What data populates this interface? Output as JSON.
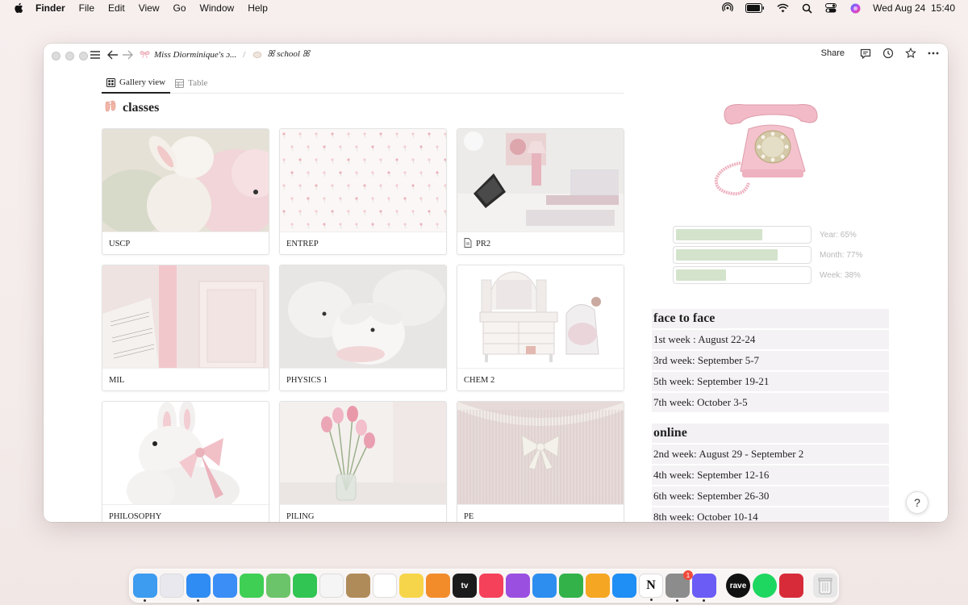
{
  "menubar": {
    "app_name": "Finder",
    "menus": [
      "File",
      "Edit",
      "View",
      "Go",
      "Window",
      "Help"
    ],
    "datetime": "Wed Aug 24  15:40"
  },
  "window": {
    "breadcrumb": {
      "page1": "Miss Diorminique's ɔ...",
      "page2": "ꕤ school ꕤ"
    },
    "share_label": "Share"
  },
  "tabs": [
    {
      "label": "Gallery view",
      "active": true
    },
    {
      "label": "Table",
      "active": false
    }
  ],
  "section_title": "classes",
  "cards": [
    {
      "label": "USCP",
      "thumb": "bunny-plush"
    },
    {
      "label": "ENTREP",
      "thumb": "floral-pattern"
    },
    {
      "label": "PR2",
      "thumb": "desk",
      "has_page_icon": true
    },
    {
      "label": "MIL",
      "thumb": "sheet-music"
    },
    {
      "label": "PHYSICS 1",
      "thumb": "white-bunny"
    },
    {
      "label": "CHEM 2",
      "thumb": "vanity"
    },
    {
      "label": "PHILOSOPHY",
      "thumb": "bunny-bow"
    },
    {
      "label": "PILING",
      "thumb": "tulips"
    },
    {
      "label": "PE",
      "thumb": "knit-bow"
    }
  ],
  "progress": [
    {
      "label": "Year: 65%",
      "value": 0.65
    },
    {
      "label": "Month: 77%",
      "value": 0.77
    },
    {
      "label": "Week: 38%",
      "value": 0.38
    }
  ],
  "face_to_face": {
    "title": "face to face",
    "items": [
      "1st week : August 22-24",
      "3rd week: September 5-7",
      "5th week: September 19-21",
      "7th week: October 3-5"
    ]
  },
  "online": {
    "title": "online",
    "items": [
      "2nd week: August 29 - September 2",
      "4th week: September 12-16",
      "6th week: September 26-30",
      "8th week: October 10-14"
    ]
  },
  "help_label": "?",
  "dock": {
    "apps": [
      {
        "name": "finder",
        "color": "#3d9bf0"
      },
      {
        "name": "launchpad",
        "color": "#e8e8ee"
      },
      {
        "name": "safari",
        "color": "#2f8cf2"
      },
      {
        "name": "mail",
        "color": "#3a8ef6"
      },
      {
        "name": "messages",
        "color": "#3fcf55"
      },
      {
        "name": "maps",
        "color": "#6cc46a"
      },
      {
        "name": "facetime",
        "color": "#31c553"
      },
      {
        "name": "photos",
        "color": "#f5f5f5"
      },
      {
        "name": "contacts",
        "color": "#b08b5a"
      },
      {
        "name": "reminders",
        "color": "#ffffff"
      },
      {
        "name": "notes",
        "color": "#f7d54a"
      },
      {
        "name": "books",
        "color": "#f28c2b"
      },
      {
        "name": "tv",
        "color": "#1b1b1b"
      },
      {
        "name": "music",
        "color": "#f5415a"
      },
      {
        "name": "podcasts",
        "color": "#9b4fe0"
      },
      {
        "name": "keynote",
        "color": "#2d8ef0"
      },
      {
        "name": "numbers",
        "color": "#33b24a"
      },
      {
        "name": "pages",
        "color": "#f5a623"
      },
      {
        "name": "app-store",
        "color": "#1f8ef5"
      },
      {
        "name": "notion",
        "color": "#ffffff"
      },
      {
        "name": "system-preferences",
        "color": "#8c8c8c"
      },
      {
        "name": "messenger",
        "color": "#6a5cf5"
      }
    ],
    "extra_apps": [
      {
        "name": "rave",
        "color": "#111111",
        "text": "rave"
      },
      {
        "name": "spotify",
        "color": "#1ed760"
      },
      {
        "name": "photo-booth",
        "color": "#d82b3a"
      }
    ],
    "badge_count": "1"
  }
}
